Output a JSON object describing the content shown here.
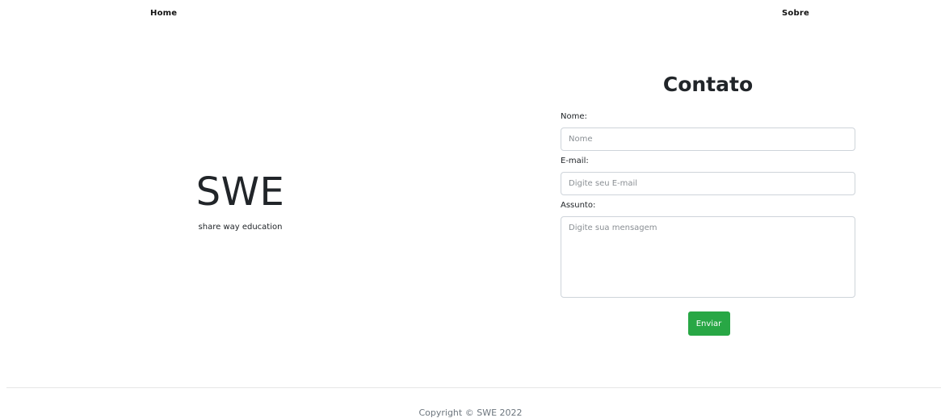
{
  "nav": {
    "home_label": "Home",
    "about_label": "Sobre"
  },
  "brand": {
    "logo": "SWE",
    "tagline": "share way education"
  },
  "contact": {
    "title": "Contato",
    "name_label": "Nome:",
    "name_placeholder": "Nome",
    "email_label": "E-mail:",
    "email_placeholder": "Digite seu E-mail",
    "subject_label": "Assunto:",
    "message_placeholder": "Digite sua mensagem",
    "submit_label": "Enviar",
    "submit_color": "#28a745"
  },
  "footer": {
    "copyright": "Copyright © SWE 2022"
  }
}
